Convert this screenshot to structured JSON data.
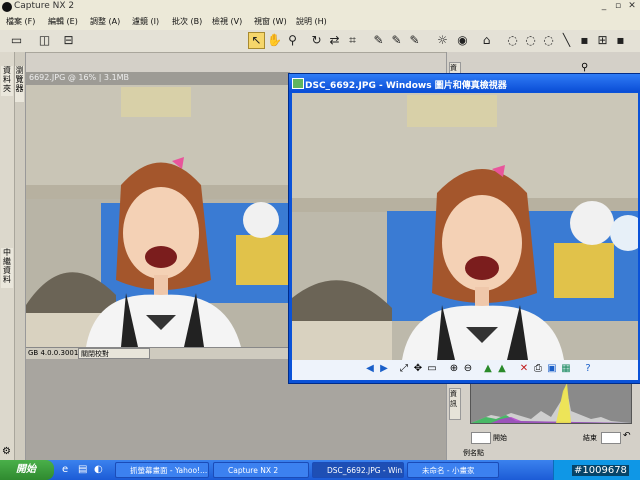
{
  "app": {
    "title": "Capture NX 2"
  },
  "menu": [
    {
      "label": "檔案 (F)"
    },
    {
      "label": "編輯 (E)"
    },
    {
      "label": "調整 (A)"
    },
    {
      "label": "濾鏡 (I)"
    },
    {
      "label": "批次 (B)"
    },
    {
      "label": "檢視 (V)"
    },
    {
      "label": "視窗 (W)"
    },
    {
      "label": "說明 (H)"
    }
  ],
  "left_tabs": {
    "browser": "資料夾",
    "browser2": "瀏覽器",
    "metadata": "中繼資料"
  },
  "pane": {
    "header": "6692.JPG @ 16% | 3.1MB",
    "footer_left": "GB 4.0.0.3001",
    "footer_select": "關閉校對"
  },
  "viewer": {
    "title": "DSC_6692.JPG - Windows 圖片和傳真檢視器"
  },
  "right_panel": {
    "start_label": "開始",
    "end_label": "結束",
    "section_label": "資訊",
    "bottom_label": "例名點"
  },
  "taskbar": {
    "start": "開始",
    "tasks": [
      {
        "label": "抓螢幕畫面 - Yahoo!..."
      },
      {
        "label": "Capture NX 2"
      },
      {
        "label": "DSC_6692.JPG - Win..."
      },
      {
        "label": "未命名 - 小畫家"
      }
    ]
  },
  "watermark": "#1009678",
  "colors": {
    "taskbar": "#1c5bd6",
    "viewer_title": "#0a4dd6",
    "start": "#2f8a2f"
  }
}
